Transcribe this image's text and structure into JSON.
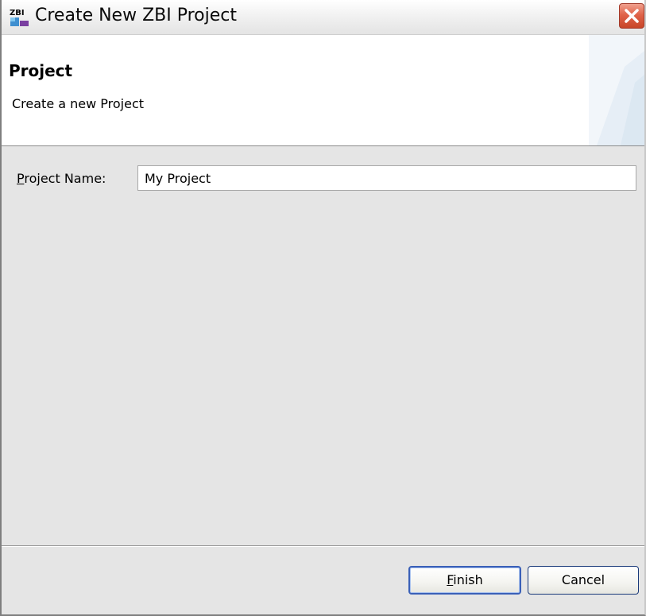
{
  "window": {
    "title": "Create New ZBI Project",
    "icon_label": "ZBI",
    "close_icon": "close-icon"
  },
  "header": {
    "title": "Project",
    "description": "Create a new Project"
  },
  "form": {
    "project_name_label_mnemonic": "P",
    "project_name_label_rest": "roject Name:",
    "project_name_value": "My Project"
  },
  "buttons": {
    "finish_mnemonic": "F",
    "finish_rest": "inish",
    "cancel_label": "Cancel"
  },
  "colors": {
    "dialog_bg": "#e5e5e5",
    "header_bg": "#ffffff",
    "close_red": "#e0644a",
    "default_button_border": "#3a60b8"
  }
}
